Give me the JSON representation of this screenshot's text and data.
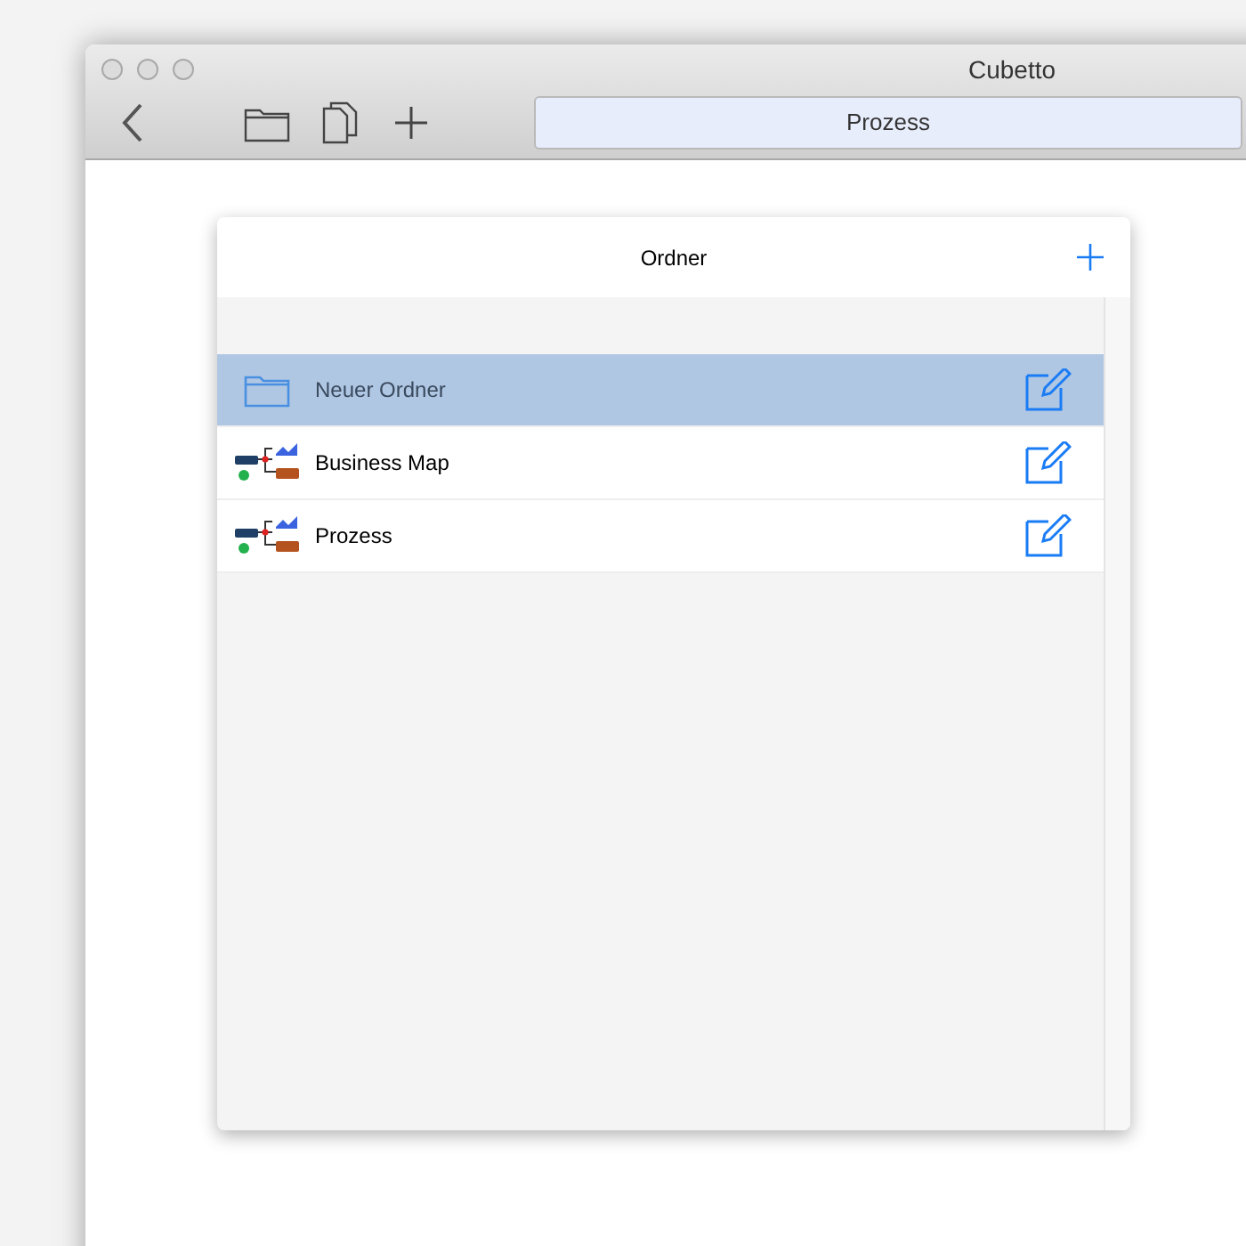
{
  "window": {
    "title": "Cubetto"
  },
  "toolbar": {
    "document_tab": "Prozess"
  },
  "panel": {
    "title": "Ordner",
    "items": [
      {
        "kind": "folder",
        "label": "Neuer Ordner",
        "selected": true
      },
      {
        "kind": "diagram",
        "label": "Business Map",
        "selected": false
      },
      {
        "kind": "diagram",
        "label": "Prozess",
        "selected": false
      }
    ]
  }
}
